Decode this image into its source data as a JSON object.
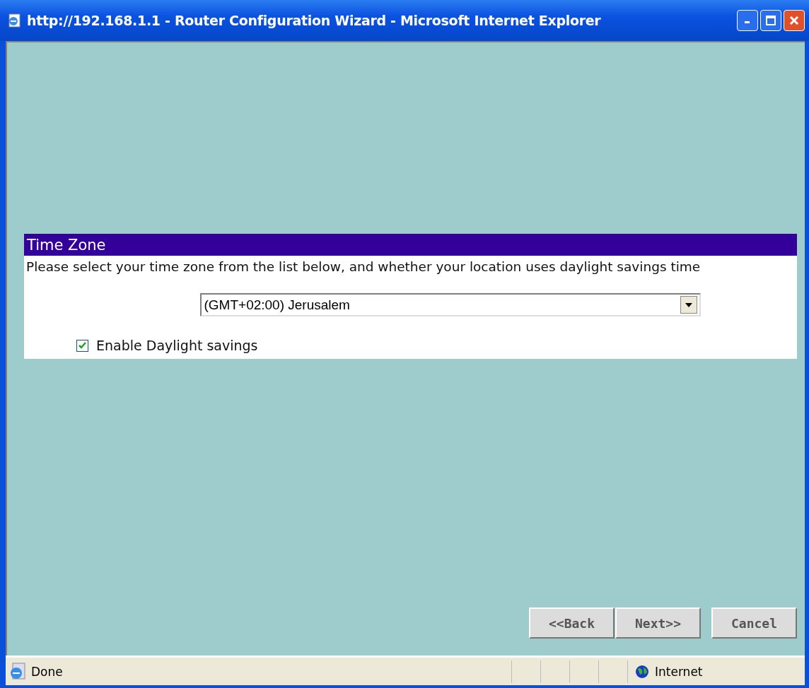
{
  "window": {
    "title": "http://192.168.1.1 - Router Configuration Wizard - Microsoft Internet Explorer"
  },
  "section": {
    "title": "Time Zone",
    "description": "Please select your time zone from the list below, and whether your location uses daylight savings time",
    "time_zone": "(GMT+02:00) Jerusalem",
    "daylight_savings": {
      "label": "Enable Daylight savings",
      "checked": true
    }
  },
  "buttons": [
    "<<Back",
    "Next>>",
    "Cancel"
  ],
  "status_bar": {
    "status": "Done",
    "zone": "Internet"
  }
}
